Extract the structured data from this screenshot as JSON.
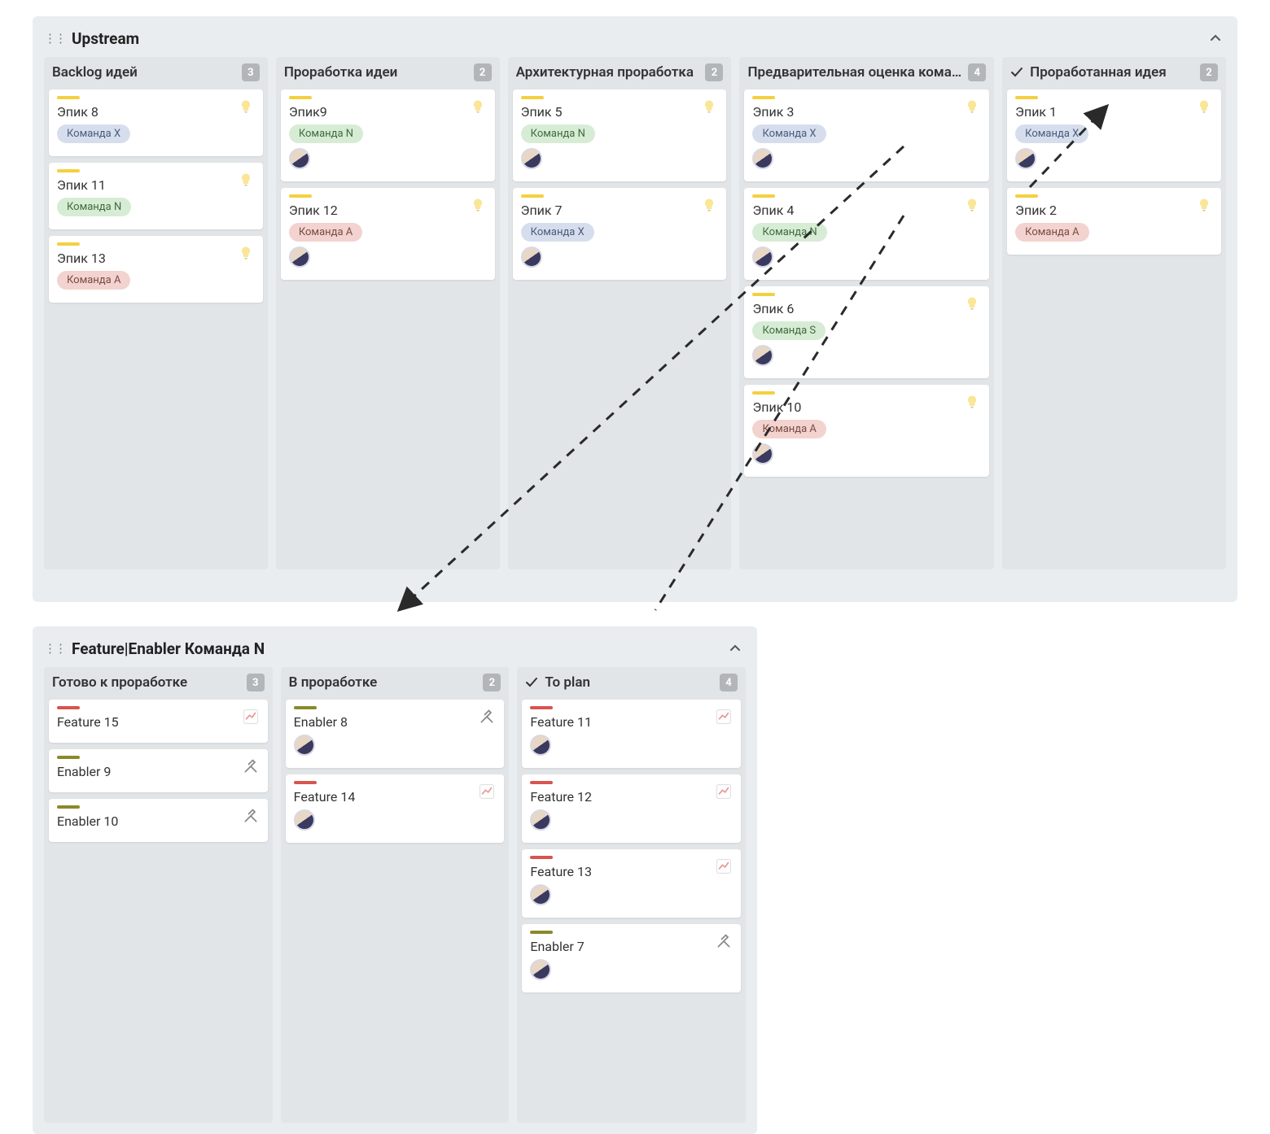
{
  "boards": [
    {
      "title": "Upstream",
      "columns": [
        {
          "title": "Backlog идей",
          "count": "3",
          "done": false,
          "cards": [
            {
              "title": "Эпик 8",
              "stripe": "yellow",
              "tag": "Команда X",
              "tagColor": "blue",
              "icon": "bulb",
              "avatar": false
            },
            {
              "title": "Эпик 11",
              "stripe": "yellow",
              "tag": "Команда N",
              "tagColor": "green",
              "icon": "bulb",
              "avatar": false
            },
            {
              "title": "Эпик 13",
              "stripe": "yellow",
              "tag": "Команда A",
              "tagColor": "pink",
              "icon": "bulb",
              "avatar": false
            }
          ]
        },
        {
          "title": "Проработка идеи",
          "count": "2",
          "done": false,
          "cards": [
            {
              "title": "Эпик9",
              "stripe": "yellow",
              "tag": "Команда N",
              "tagColor": "green",
              "icon": "bulb",
              "avatar": true
            },
            {
              "title": "Эпик 12",
              "stripe": "yellow",
              "tag": "Команда A",
              "tagColor": "pink",
              "icon": "bulb",
              "avatar": true
            }
          ]
        },
        {
          "title": "Архитектурная проработка",
          "count": "2",
          "done": false,
          "cards": [
            {
              "title": "Эпик 5",
              "stripe": "yellow",
              "tag": "Команда N",
              "tagColor": "green",
              "icon": "bulb",
              "avatar": true
            },
            {
              "title": "Эпик 7",
              "stripe": "yellow",
              "tag": "Команда X",
              "tagColor": "blue",
              "icon": "bulb",
              "avatar": true
            }
          ]
        },
        {
          "title": "Предварительная оценка кома…",
          "count": "4",
          "done": false,
          "cards": [
            {
              "title": "Эпик 3",
              "stripe": "yellow",
              "tag": "Команда X",
              "tagColor": "blue",
              "icon": "bulb",
              "avatar": true
            },
            {
              "title": "Эпик 4",
              "stripe": "yellow",
              "tag": "Команда N",
              "tagColor": "green",
              "icon": "bulb",
              "avatar": true
            },
            {
              "title": "Эпик 6",
              "stripe": "yellow",
              "tag": "Команда S",
              "tagColor": "green",
              "icon": "bulb",
              "avatar": true
            },
            {
              "title": "Эпик 10",
              "stripe": "yellow",
              "tag": "Команда A",
              "tagColor": "pink",
              "icon": "bulb",
              "avatar": true
            }
          ]
        },
        {
          "title": "Проработанная идея",
          "count": "2",
          "done": true,
          "cards": [
            {
              "title": "Эпик 1",
              "stripe": "yellow",
              "tag": "Команда X",
              "tagColor": "blue",
              "icon": "bulb",
              "avatar": true
            },
            {
              "title": "Эпик 2",
              "stripe": "yellow",
              "tag": "Команда A",
              "tagColor": "pink",
              "icon": "bulb",
              "avatar": false
            }
          ]
        }
      ]
    },
    {
      "title": "Feature|Enabler Команда N",
      "columns": [
        {
          "title": "Готово к проработке",
          "count": "3",
          "done": false,
          "cards": [
            {
              "title": "Feature 15",
              "stripe": "red",
              "tag": null,
              "icon": "chart",
              "avatar": false
            },
            {
              "title": "Enabler 9",
              "stripe": "olive",
              "tag": null,
              "icon": "hammer",
              "avatar": false
            },
            {
              "title": "Enabler 10",
              "stripe": "olive",
              "tag": null,
              "icon": "hammer",
              "avatar": false
            }
          ]
        },
        {
          "title": "В проработке",
          "count": "2",
          "done": false,
          "cards": [
            {
              "title": "Enabler 8",
              "stripe": "olive",
              "tag": null,
              "icon": "hammer",
              "avatar": true
            },
            {
              "title": "Feature 14",
              "stripe": "red",
              "tag": null,
              "icon": "chart",
              "avatar": true
            }
          ]
        },
        {
          "title": "To plan",
          "count": "4",
          "done": true,
          "cards": [
            {
              "title": "Feature 11",
              "stripe": "red",
              "tag": null,
              "icon": "chart",
              "avatar": true
            },
            {
              "title": "Feature 12",
              "stripe": "red",
              "tag": null,
              "icon": "chart",
              "avatar": true
            },
            {
              "title": "Feature 13",
              "stripe": "red",
              "tag": null,
              "icon": "chart",
              "avatar": true
            },
            {
              "title": "Enabler 7",
              "stripe": "olive",
              "tag": null,
              "icon": "hammer",
              "avatar": true
            }
          ]
        }
      ]
    }
  ]
}
